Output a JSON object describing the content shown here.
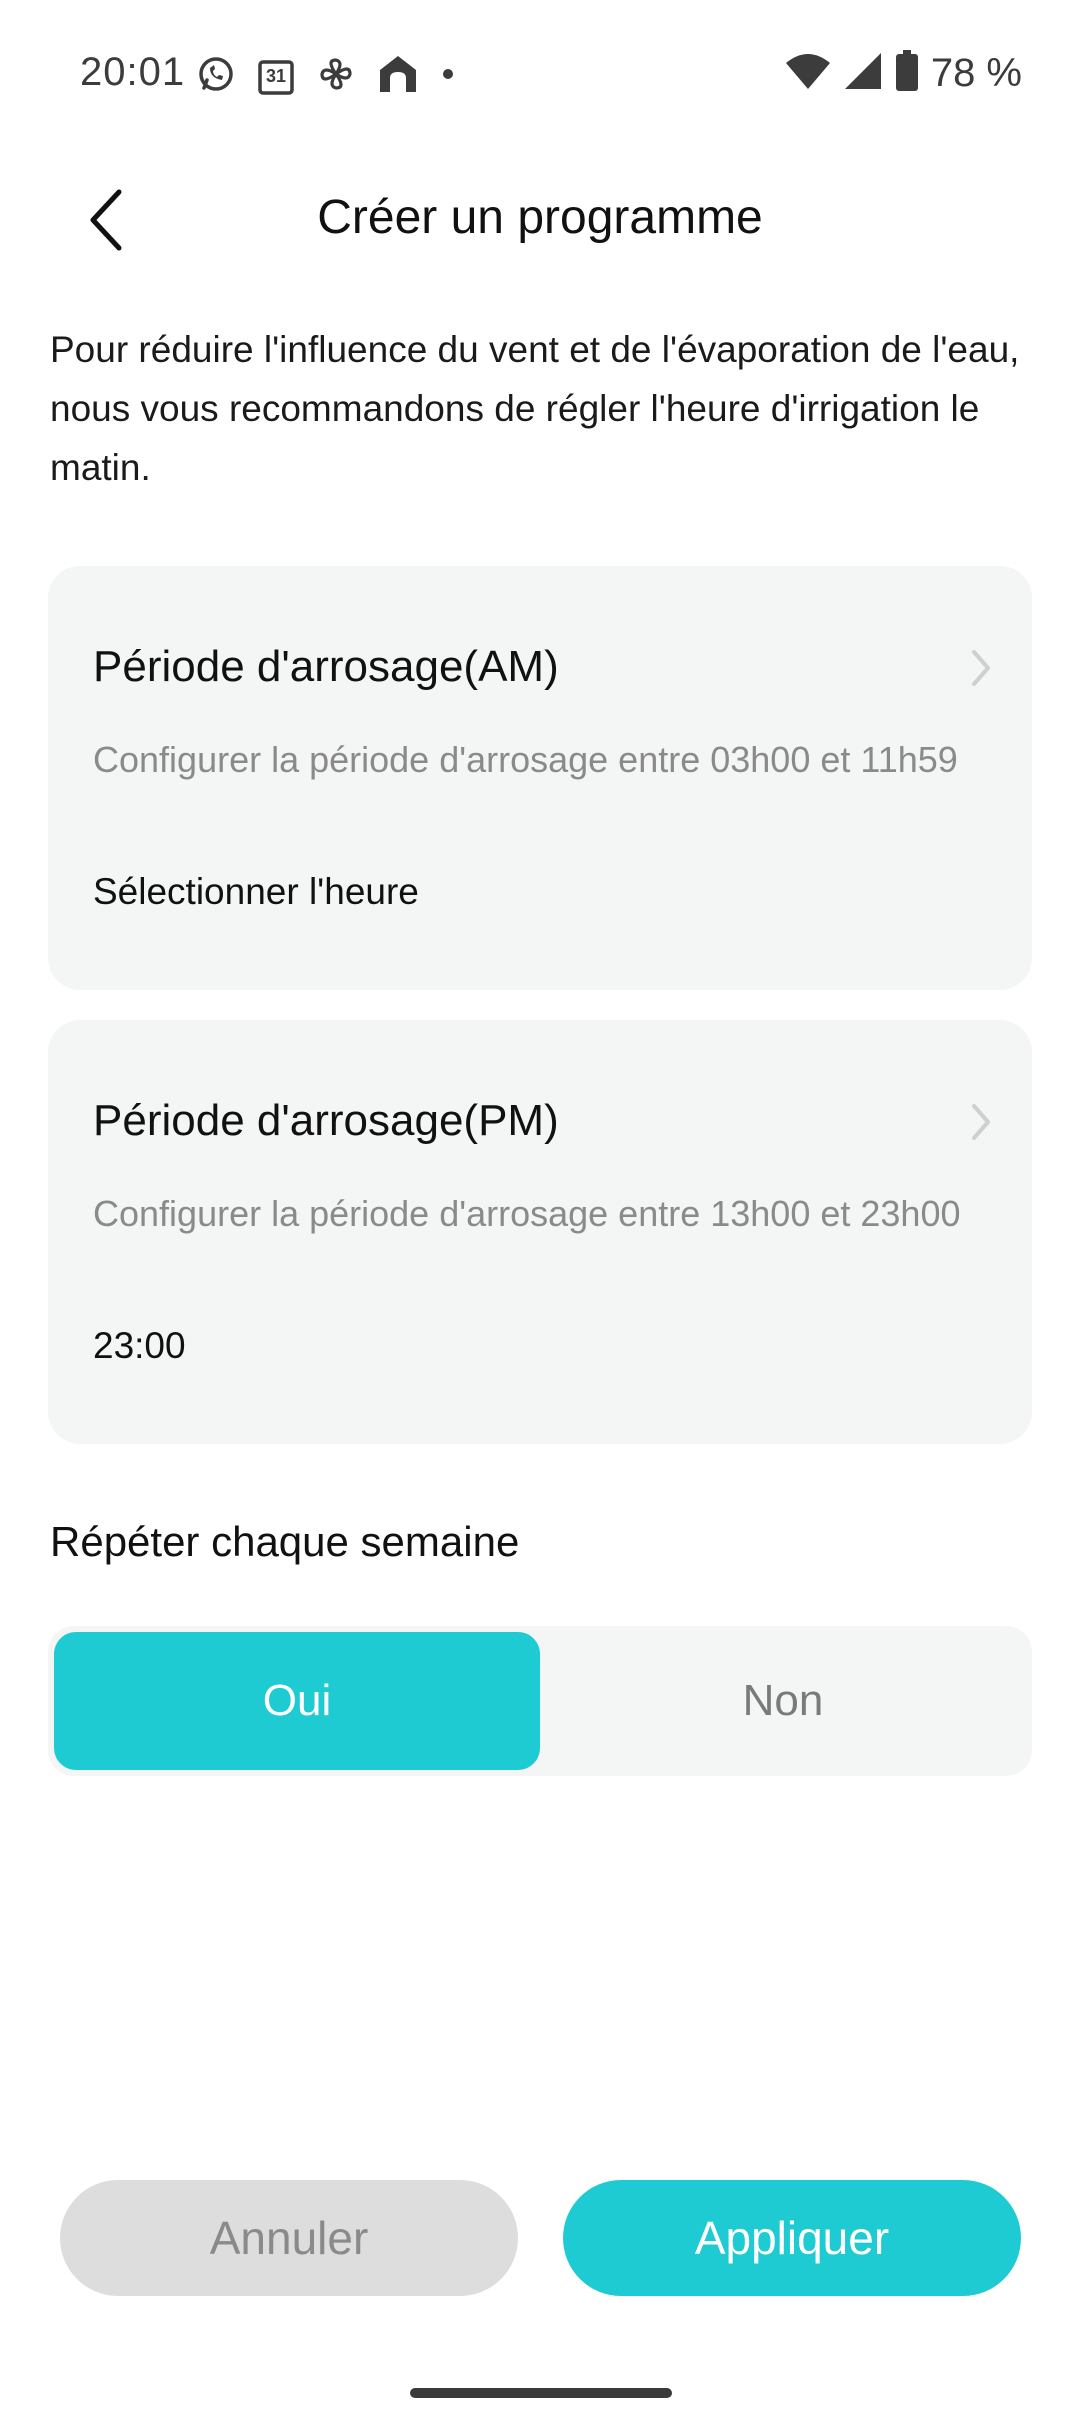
{
  "status_bar": {
    "time": "20:01",
    "battery": "78 %",
    "left_icons": [
      "whatsapp-icon",
      "calendar-icon",
      "pinwheel-icon",
      "home-app-icon",
      "dot-icon"
    ],
    "calendar_day": "31",
    "right_icons": [
      "wifi-icon",
      "signal-icon",
      "battery-icon"
    ]
  },
  "header": {
    "title": "Créer un programme",
    "back_icon": "chevron-left-icon"
  },
  "intro_text": "Pour réduire l'influence du vent et de l'évaporation de l'eau, nous vous recommandons de régler l'heure d'irrigation le matin.",
  "cards": [
    {
      "title": "Période d'arrosage(AM)",
      "description": "Configurer la période d'arrosage entre 03h00 et 11h59",
      "value": "Sélectionner l'heure"
    },
    {
      "title": "Période d'arrosage(PM)",
      "description": "Configurer la période d'arrosage entre 13h00 et 23h00",
      "value": "23:00"
    }
  ],
  "repeat": {
    "title": "Répéter chaque semaine",
    "options": [
      "Oui",
      "Non"
    ],
    "selected": "Oui"
  },
  "actions": {
    "cancel": "Annuler",
    "apply": "Appliquer"
  },
  "colors": {
    "accent": "#1ecbd3",
    "card_bg": "#f4f5f5",
    "muted_text": "#8a8a8a",
    "cancel_bg": "#dddddd"
  }
}
